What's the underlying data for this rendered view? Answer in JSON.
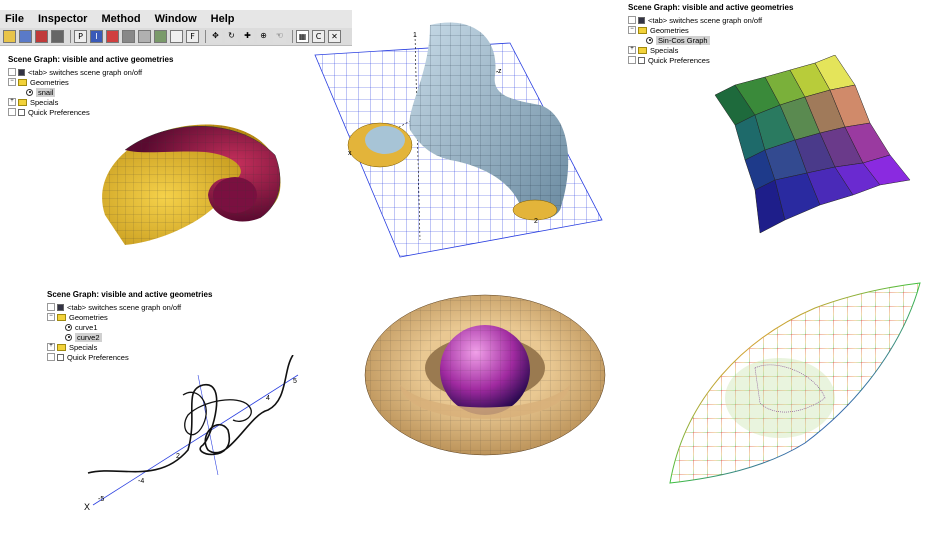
{
  "menu": [
    "File",
    "Inspector",
    "Method",
    "Window",
    "Help"
  ],
  "toolbar_icons": [
    "open-icon",
    "save-icon",
    "print-icon",
    "camera-icon",
    "label-icon",
    "info-icon",
    "color-icon",
    "axes-icon",
    "bounding-box-icon",
    "display-icon",
    "light-icon",
    "material-icon",
    "move-icon",
    "rotate-icon",
    "translate-icon",
    "zoom-icon",
    "grid-icon",
    "center-icon",
    "close-icon"
  ],
  "toolbar_labels": {
    "p": "P",
    "i": "I",
    "f": "F",
    "c": "C"
  },
  "scene_graph": {
    "title": "Scene Graph: visible and active geometries",
    "tab_hint": "<tab> switches scene graph on/off",
    "geometries": "Geometries",
    "specials": "Specials",
    "quick_prefs": "Quick Preferences"
  },
  "panel1": {
    "geometry": "snail"
  },
  "panel3": {
    "geometry": "Sin-Cos Graph"
  },
  "panel4": {
    "geometries": [
      "curve1",
      "curve2"
    ]
  },
  "panel2_labels": {
    "axis_y": "1",
    "axis_x": "x",
    "axis_z": "2",
    "axis_z2": "z"
  },
  "panel4_labels": {
    "x": "X",
    "t1": "2",
    "t2": "4",
    "t3": "-4",
    "t4": "-5",
    "t5": "5"
  }
}
